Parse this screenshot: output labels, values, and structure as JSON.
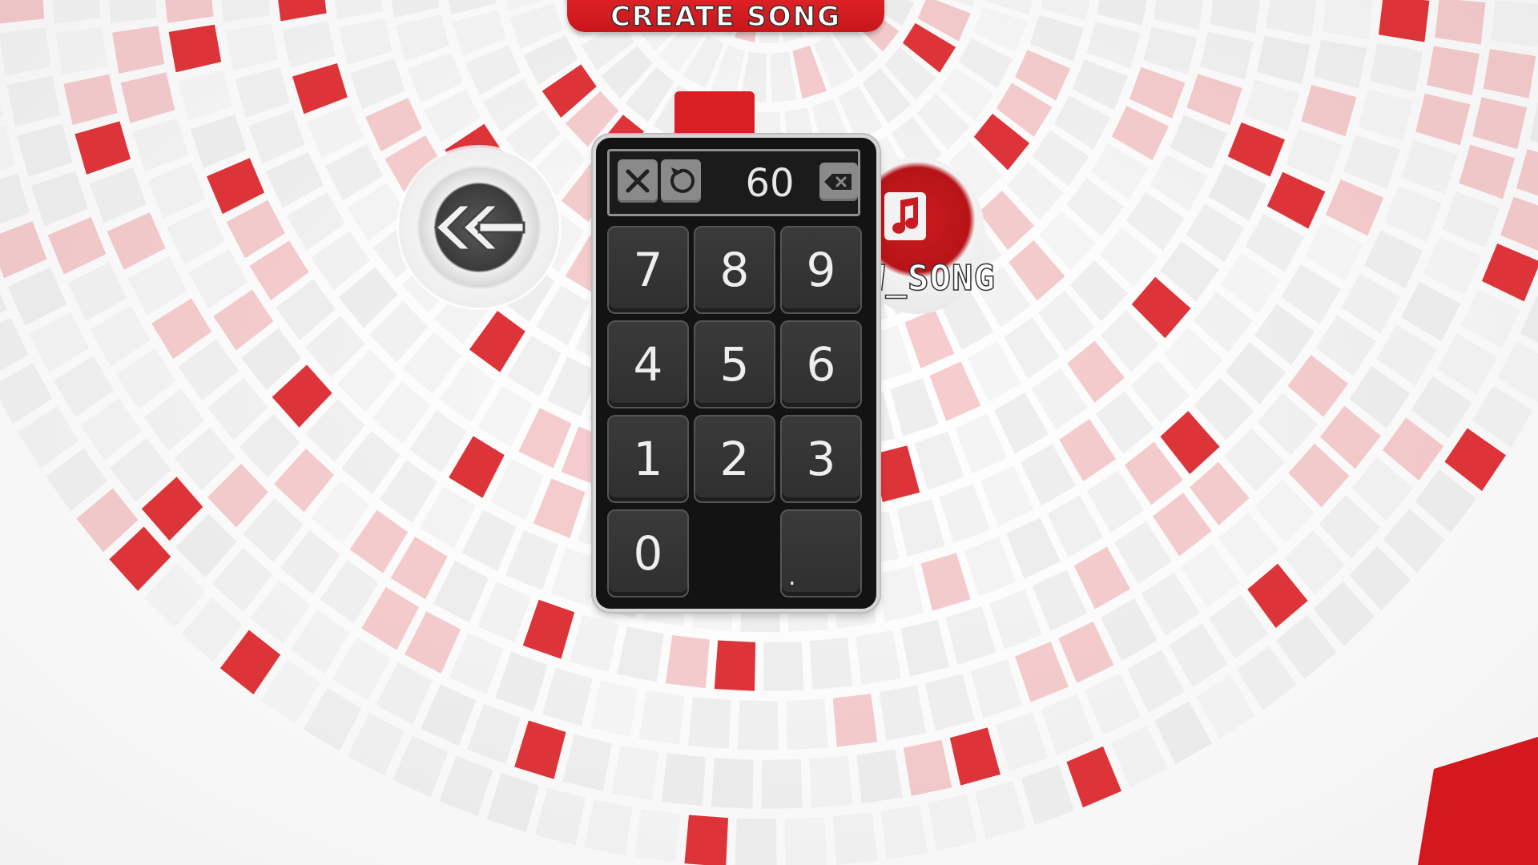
{
  "banner": {
    "label": "CREATE SONG"
  },
  "new_song": {
    "label": "W_SONG"
  },
  "keypad": {
    "display_value": "60",
    "keys": [
      {
        "label": "7"
      },
      {
        "label": "8"
      },
      {
        "label": "9"
      },
      {
        "label": "4"
      },
      {
        "label": "5"
      },
      {
        "label": "6"
      },
      {
        "label": "1"
      },
      {
        "label": "2"
      },
      {
        "label": "3"
      },
      {
        "label": "0"
      },
      {
        "label": "."
      }
    ]
  },
  "colors": {
    "accent": "#d91e24",
    "panel": "#131313",
    "key": "#333333"
  },
  "icons": {
    "close": "close-icon",
    "reset": "reset-icon",
    "backspace": "backspace-icon",
    "back": "double-chevron-left-icon",
    "music": "music-note-icon"
  }
}
